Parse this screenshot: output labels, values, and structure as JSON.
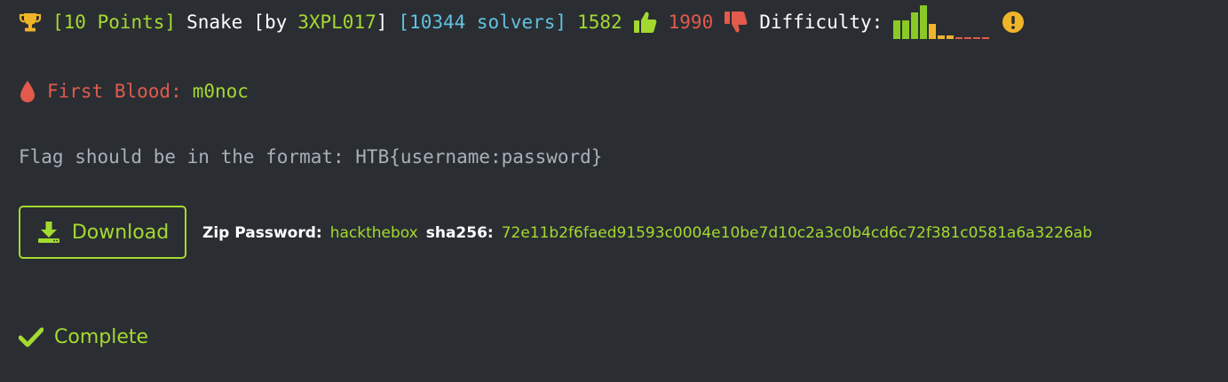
{
  "challenge": {
    "points": "[10 Points]",
    "name": "Snake",
    "by_prefix": "[by",
    "author": "3XPL017",
    "by_suffix": "]",
    "solvers": "[10344 solvers]",
    "likes": "1582",
    "dislikes": "1990",
    "difficulty_label": "Difficulty:"
  },
  "difficulty_bars": [
    {
      "level": 0.55,
      "color": "#8ac926"
    },
    {
      "level": 0.55,
      "color": "#8ac926"
    },
    {
      "level": 0.8,
      "color": "#8ac926"
    },
    {
      "level": 1.0,
      "color": "#8ac926"
    },
    {
      "level": 0.45,
      "color": "#f0b429"
    },
    {
      "level": 0.1,
      "color": "#f0b429"
    },
    {
      "level": 0.1,
      "color": "#f0b429"
    },
    {
      "level": 0.05,
      "color": "#e25a4c"
    },
    {
      "level": 0.05,
      "color": "#e25a4c"
    },
    {
      "level": 0.05,
      "color": "#e25a4c"
    },
    {
      "level": 0.05,
      "color": "#e25a4c"
    }
  ],
  "first_blood": {
    "label": "First Blood:",
    "user": "m0noc"
  },
  "flag_format": "Flag should be in the format: HTB{username:password}",
  "download": {
    "label": "Download"
  },
  "zip": {
    "password_label": "Zip Password:",
    "password": "hackthebox",
    "sha_label": "sha256:",
    "sha": "72e11b2f6faed91593c0004e10be7d10c2a3c0b4cd6c72f381c0581a6a3226ab"
  },
  "status": {
    "label": "Complete"
  },
  "colors": {
    "background": "#2a2e33",
    "accent_green": "#a4d930",
    "blue": "#62c0e0",
    "red": "#e25a4c",
    "yellow": "#f0b429"
  },
  "icons": {
    "trophy": "trophy-icon",
    "thumbs_up": "thumbs-up-icon",
    "thumbs_down": "thumbs-down-icon",
    "warning": "exclamation-circle-icon",
    "blood": "blood-drop-icon",
    "download": "download-icon",
    "complete": "check-icon"
  }
}
